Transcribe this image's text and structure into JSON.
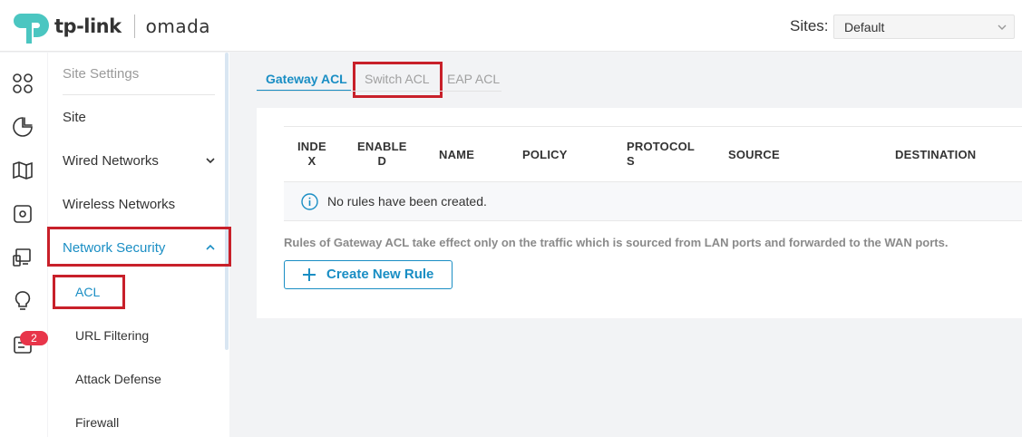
{
  "header": {
    "brand": "tp-link",
    "product": "omada",
    "sites_label": "Sites:",
    "site_selected": "Default"
  },
  "rail": {
    "icons": [
      "dashboard-icon",
      "statistics-icon",
      "map-icon",
      "devices-icon",
      "clients-icon",
      "insight-icon",
      "log-icon"
    ],
    "log_badge": "2"
  },
  "subnav": {
    "heading": "Site Settings",
    "items": [
      {
        "label": "Site"
      },
      {
        "label": "Wired Networks"
      },
      {
        "label": "Wireless Networks"
      },
      {
        "label": "Network Security"
      }
    ],
    "sub_items": [
      {
        "label": "ACL"
      },
      {
        "label": "URL Filtering"
      },
      {
        "label": "Attack Defense"
      },
      {
        "label": "Firewall"
      }
    ]
  },
  "tabs": [
    {
      "label": "Gateway ACL"
    },
    {
      "label": "Switch ACL"
    },
    {
      "label": "EAP ACL"
    }
  ],
  "table": {
    "columns": [
      {
        "line1": "INDE",
        "line2": "X"
      },
      {
        "line1": "ENABLE",
        "line2": "D"
      },
      {
        "line1": "NAME"
      },
      {
        "line1": "POLICY"
      },
      {
        "line1": "PROTOCOL",
        "line2": "S"
      },
      {
        "line1": "SOURCE"
      },
      {
        "line1": "DESTINATION"
      }
    ],
    "empty_message": "No rules have been created."
  },
  "note": "Rules of Gateway ACL take effect only on the traffic which is sourced from LAN ports and forwarded to the WAN ports.",
  "create_button": "Create New Rule",
  "colors": {
    "accent": "#1a8ec4",
    "highlight": "#c8202a",
    "badge": "#e8354a"
  }
}
